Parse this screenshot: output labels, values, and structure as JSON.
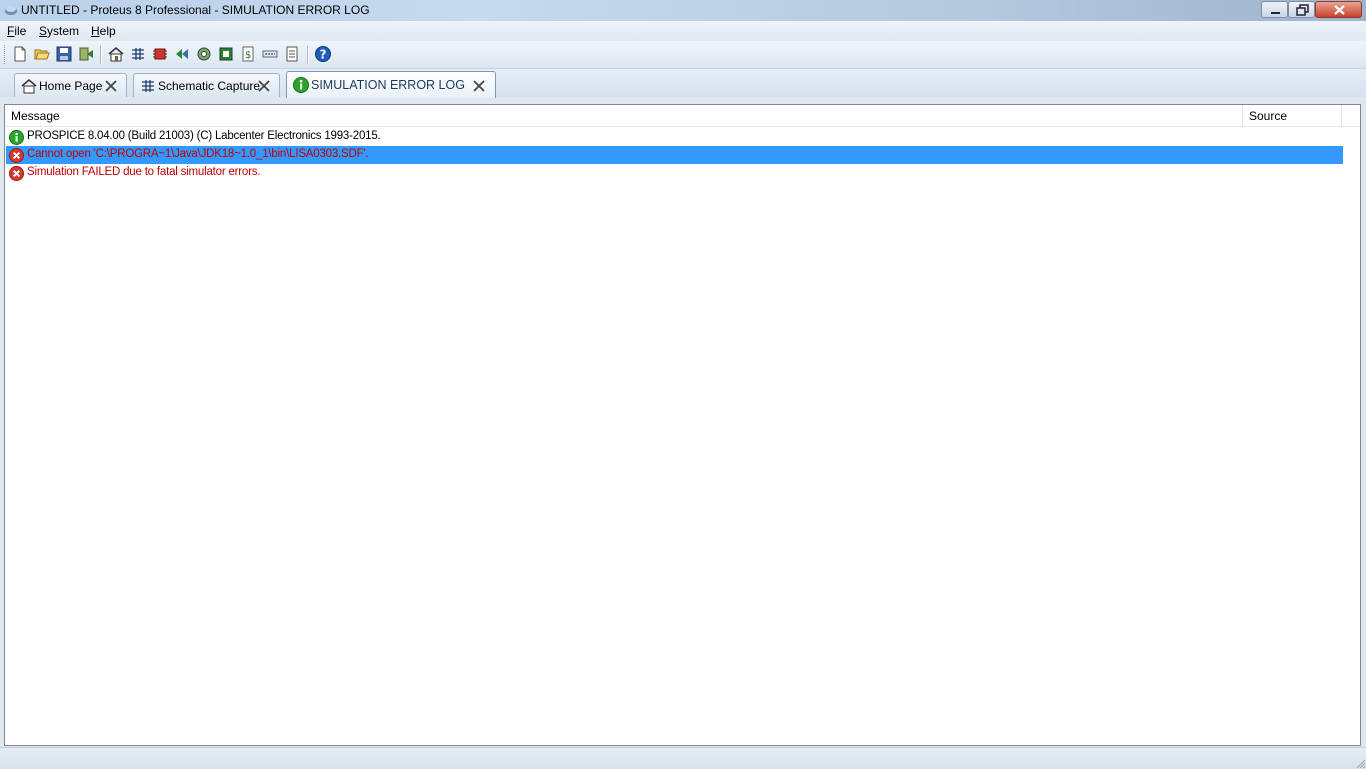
{
  "window": {
    "title": "UNTITLED - Proteus 8 Professional - SIMULATION ERROR LOG"
  },
  "menu": {
    "items": [
      {
        "label": "File"
      },
      {
        "label": "System"
      },
      {
        "label": "Help"
      }
    ]
  },
  "toolbar": {
    "buttons": [
      "new-file-icon",
      "open-folder-icon",
      "save-icon",
      "import-icon",
      "home-icon",
      "schematic-icon",
      "pcb-icon",
      "gerber-icon",
      "3d-viewer-icon",
      "source-code-icon",
      "bill-of-materials-icon",
      "design-explorer-icon",
      "notes-icon",
      "help-icon"
    ]
  },
  "tabs": [
    {
      "label": "Home Page",
      "icon": "home-icon",
      "active": false
    },
    {
      "label": "Schematic Capture",
      "icon": "schematic-icon",
      "active": false
    },
    {
      "label": "SIMULATION ERROR LOG",
      "icon": "info-icon",
      "active": true
    }
  ],
  "log": {
    "columns": {
      "message": "Message",
      "source": "Source"
    },
    "rows": [
      {
        "type": "info",
        "message": "PROSPICE 8.04.00 (Build 21003) (C) Labcenter Electronics 1993-2015.",
        "source": "",
        "selected": false
      },
      {
        "type": "error",
        "message": "Cannot open 'C:\\PROGRA~1\\Java\\JDK18~1.0_1\\bin\\LISA0303.SDF'.",
        "source": "",
        "selected": true
      },
      {
        "type": "error",
        "message": "Simulation FAILED due to fatal simulator errors.",
        "source": "",
        "selected": false
      }
    ]
  },
  "colors": {
    "selection": "#3399ff",
    "error_text": "#c00000",
    "info_icon": "#2aa52a",
    "error_icon": "#d63a2f"
  }
}
